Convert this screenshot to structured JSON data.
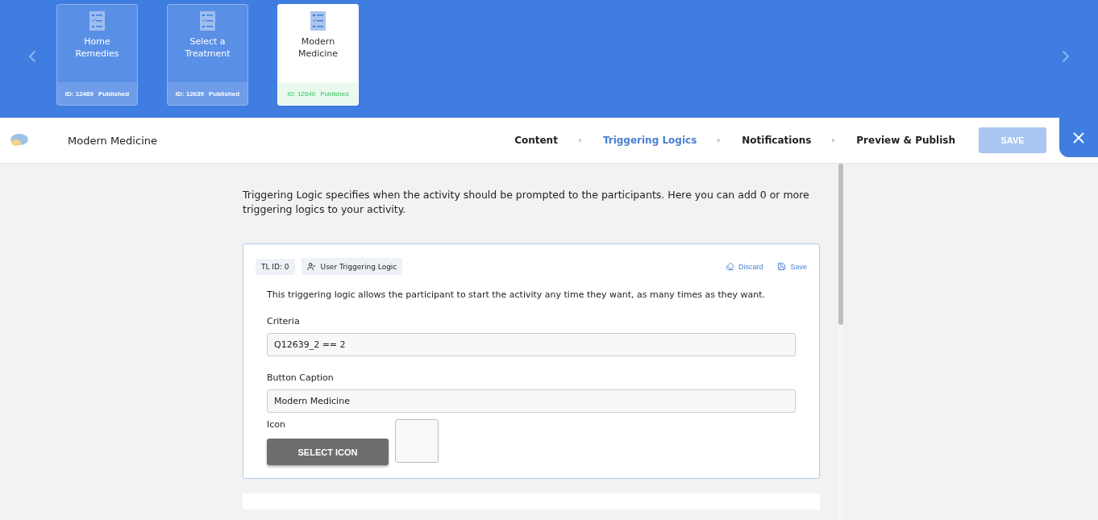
{
  "activities": [
    {
      "title": "Home Remedies",
      "id_label": "ID: 12489",
      "status": "Published",
      "selected": false
    },
    {
      "title": "Select a Treatment",
      "id_label": "ID: 12639",
      "status": "Published",
      "selected": false
    },
    {
      "title": "Modern Medicine",
      "id_label": "ID: 12640",
      "status": "Published",
      "selected": true
    }
  ],
  "header": {
    "title": "Modern Medicine",
    "steps": [
      {
        "label": "Content",
        "selected": false
      },
      {
        "label": "Triggering Logics",
        "selected": true
      },
      {
        "label": "Notifications",
        "selected": false
      },
      {
        "label": "Preview & Publish",
        "selected": false
      }
    ],
    "save_button": {
      "label": "SAVE",
      "disabled": true
    }
  },
  "intro": "Triggering Logic specifies when the activity should be prompted to the participants. Here you can add 0 or more triggering logics to your activity.",
  "logic": {
    "id_tag": "TL ID: 0",
    "type_tag": "User Triggering Logic",
    "discard": "Discard",
    "save": "Save",
    "description": "This triggering logic allows the participant to start the activity any time they want, as many times as they want.",
    "criteria": {
      "label": "Criteria",
      "value": "Q12639_2 == 2"
    },
    "caption": {
      "label": "Button Caption",
      "value": "Modern Medicine"
    },
    "icon": {
      "label": "Icon",
      "button": "SELECT ICON"
    }
  }
}
